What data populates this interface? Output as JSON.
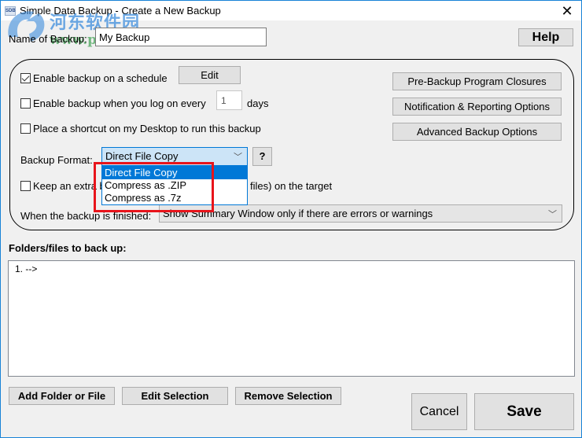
{
  "window": {
    "title": "Simple Data Backup - Create a New Backup",
    "app_icon_text": "SDB",
    "close_glyph": "✕"
  },
  "watermark": {
    "text": "河东软件园",
    "url": "www.pc0359.cn"
  },
  "header": {
    "name_label": "Name of Backup:",
    "name_value": "My Backup",
    "help_label": "Help"
  },
  "schedule": {
    "enable_schedule_label": "Enable backup on a schedule",
    "enable_schedule_checked": true,
    "edit_label": "Edit",
    "logon_label": "Enable backup when you log on every",
    "logon_checked": false,
    "logon_days_value": "1",
    "days_label": "days",
    "shortcut_label": "Place a shortcut on my Desktop to run this backup",
    "shortcut_checked": false
  },
  "options_buttons": {
    "pre_backup": "Pre-Backup Program Closures",
    "notification": "Notification & Reporting Options",
    "advanced": "Advanced Backup Options"
  },
  "format": {
    "label": "Backup Format:",
    "selected": "Direct File Copy",
    "help_label": "?",
    "options": [
      "Direct File Copy",
      "Compress as .ZIP",
      "Compress as .7z"
    ],
    "chevron": "﹀"
  },
  "extra": {
    "label_start": "Keep an extra b",
    "label_end": "files) on the target",
    "checked": false
  },
  "finish": {
    "label": "When the backup is finished:",
    "selected": "Show Summary Window only if there are errors or warnings",
    "chevron": "﹀"
  },
  "folders": {
    "label": "Folders/files to back up:",
    "items": [
      "1.  -->"
    ]
  },
  "actions": {
    "add": "Add Folder or File",
    "edit": "Edit Selection",
    "remove": "Remove Selection",
    "cancel": "Cancel",
    "save": "Save"
  },
  "colors": {
    "accent": "#0078d7",
    "highlight_box": "#e8141b",
    "window_border": "#1883d7"
  }
}
